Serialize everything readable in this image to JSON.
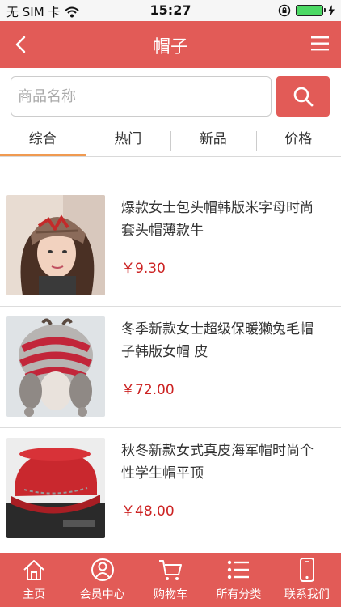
{
  "status_bar": {
    "carrier": "无 SIM 卡",
    "time": "15:27"
  },
  "header": {
    "title": "帽子"
  },
  "search": {
    "placeholder": "商品名称"
  },
  "tabs": [
    {
      "label": "综合",
      "active": true
    },
    {
      "label": "热门",
      "active": false
    },
    {
      "label": "新品",
      "active": false
    },
    {
      "label": "价格",
      "active": false
    }
  ],
  "products": [
    {
      "name": "爆款女士包头帽韩版米字母时尚套头帽薄款牛",
      "price": "￥9.30",
      "image": "knit-beanie-photo"
    },
    {
      "name": "冬季新款女士超级保暖獭兔毛帽子韩版女帽 皮",
      "price": "￥72.00",
      "image": "fur-hat-photo"
    },
    {
      "name": "秋冬新款女式真皮海军帽时尚个性学生帽平顶",
      "price": "￥48.00",
      "image": "red-navy-cap-photo"
    }
  ],
  "bottom_nav": [
    {
      "label": "主页",
      "icon": "home-icon"
    },
    {
      "label": "会员中心",
      "icon": "member-icon"
    },
    {
      "label": "购物车",
      "icon": "cart-icon"
    },
    {
      "label": "所有分类",
      "icon": "list-icon"
    },
    {
      "label": "联系我们",
      "icon": "phone-icon"
    }
  ],
  "colors": {
    "accent": "#e25b57",
    "price": "#cc2222",
    "tab_underline": "#f09a50"
  }
}
